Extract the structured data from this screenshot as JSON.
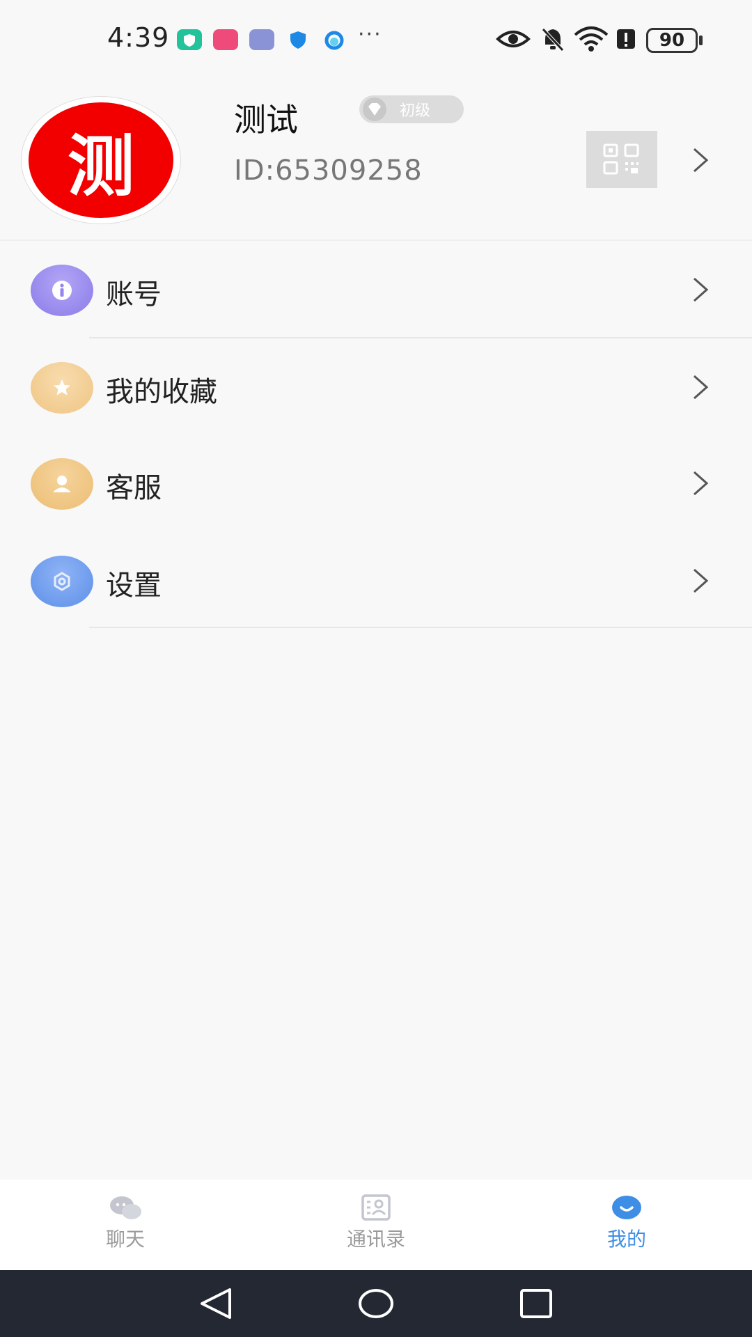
{
  "status_bar": {
    "time": "4:39",
    "battery": "90",
    "more": "···"
  },
  "profile": {
    "avatar_text": "测",
    "name": "测试",
    "level": "初级",
    "id": "ID:65309258"
  },
  "menu": [
    {
      "label": "账号",
      "icon": "info-icon",
      "color": "#9c8df0"
    },
    {
      "label": "我的收藏",
      "icon": "star-icon",
      "color": "#f2cf97"
    },
    {
      "label": "客服",
      "icon": "support-icon",
      "color": "#f0c98a"
    },
    {
      "label": "设置",
      "icon": "gear-icon",
      "color": "#6f9ff0"
    }
  ],
  "tabs": [
    {
      "label": "聊天",
      "icon": "chat-icon"
    },
    {
      "label": "通讯录",
      "icon": "contacts-icon"
    },
    {
      "label": "我的",
      "icon": "profile-icon",
      "active": true
    }
  ],
  "colors": {
    "accent": "#3f8ee6",
    "avatar_bg": "#f20000",
    "navbar": "#232833"
  }
}
